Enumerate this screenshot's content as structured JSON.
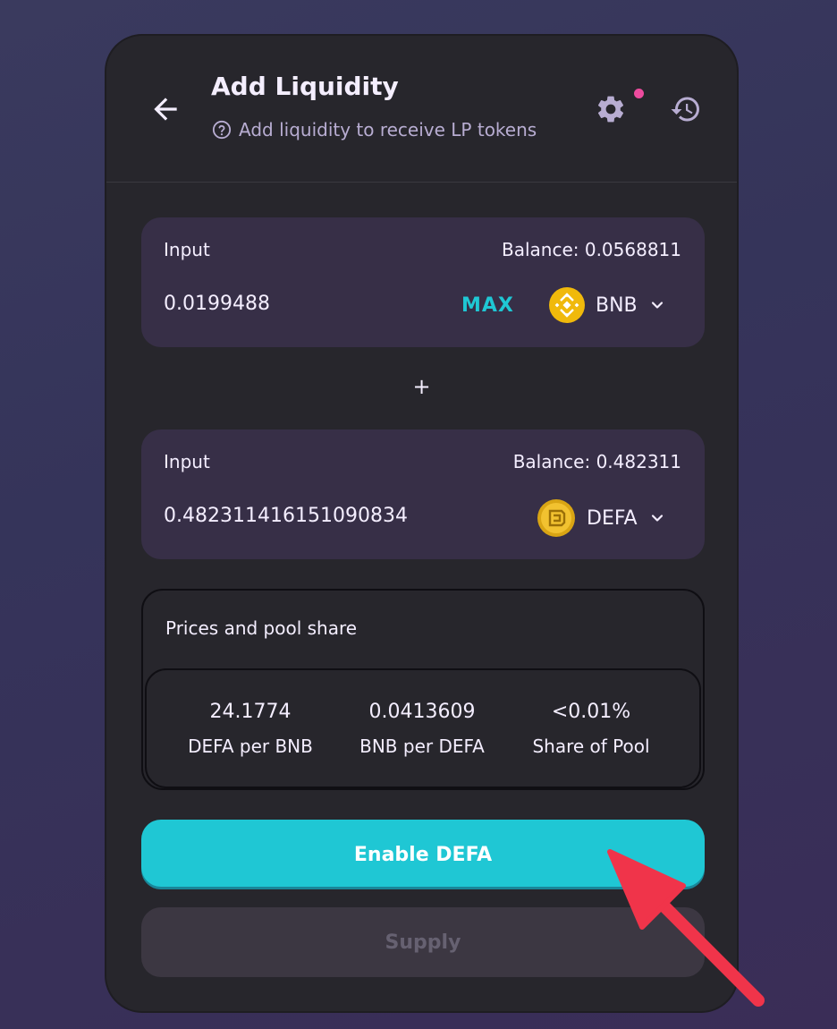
{
  "header": {
    "title": "Add Liquidity",
    "subtitle": "Add liquidity to receive LP tokens",
    "icons": [
      "arrow-left-icon",
      "help-circle-icon",
      "gear-icon",
      "history-icon"
    ],
    "notification_dot_color": "#ed4b9e"
  },
  "inputs": [
    {
      "label": "Input",
      "balance": "Balance: 0.0568811",
      "amount": "0.0199488",
      "max_label": "MAX",
      "token": "BNB",
      "token_icon": "bnb-token-icon"
    },
    {
      "label": "Input",
      "balance": "Balance: 0.482311",
      "amount": "0.482311416151090834",
      "token": "DEFA",
      "token_icon": "defa-token-icon"
    }
  ],
  "plus": "+",
  "pool": {
    "title": "Prices and pool share",
    "stats": [
      {
        "value": "24.1774",
        "label": "DEFA per BNB"
      },
      {
        "value": "0.0413609",
        "label": "BNB per DEFA"
      },
      {
        "value": "<0.01%",
        "label": "Share of Pool"
      }
    ]
  },
  "buttons": {
    "enable": "Enable DEFA",
    "supply": "Supply"
  },
  "colors": {
    "accent": "#1fc7d4",
    "card_bg": "#27262c",
    "input_bg": "#372f47",
    "text": "#f4eeff",
    "annotation_arrow": "#f0344a"
  }
}
